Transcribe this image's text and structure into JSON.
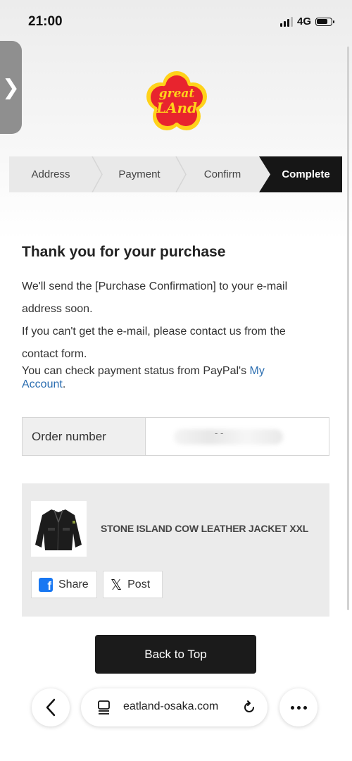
{
  "status_bar": {
    "time": "21:00",
    "network": "4G"
  },
  "side_tab": {
    "glyph": "❯"
  },
  "logo": {
    "line1": "great",
    "line2": "LAnd",
    "colors": {
      "fill": "#e8242e",
      "ring": "#ffd21a",
      "text": "#ffd21a"
    }
  },
  "steps": [
    {
      "label": "Address",
      "active": false
    },
    {
      "label": "Payment",
      "active": false
    },
    {
      "label": "Confirm",
      "active": false
    },
    {
      "label": "Complete",
      "active": true
    }
  ],
  "message": {
    "title": "Thank you for your purchase",
    "line1": "We'll send the [Purchase Confirmation] to your e-mail",
    "line2": "address soon.",
    "line3": "If you can't get the e-mail, please contact us from the",
    "line4": "contact form.",
    "line5": "You can check payment status from PayPal's",
    "link_text_a": "My",
    "link_text_b": "Account",
    "line6_end": "."
  },
  "order": {
    "label": "Order number",
    "value_redacted": "- -"
  },
  "product": {
    "name": "STONE ISLAND COW LEATHER JACKET XXL",
    "share_label": "Share",
    "post_label": "Post"
  },
  "back_to_top": "Back to Top",
  "browser": {
    "url": "eatland-osaka.com",
    "back_icon": "chevron-left-icon",
    "more_icon": "more-dots-icon"
  },
  "colors": {
    "accent_link": "#2a6db0",
    "dark_button": "#1b1b1b",
    "step_active_bg": "#161616"
  }
}
